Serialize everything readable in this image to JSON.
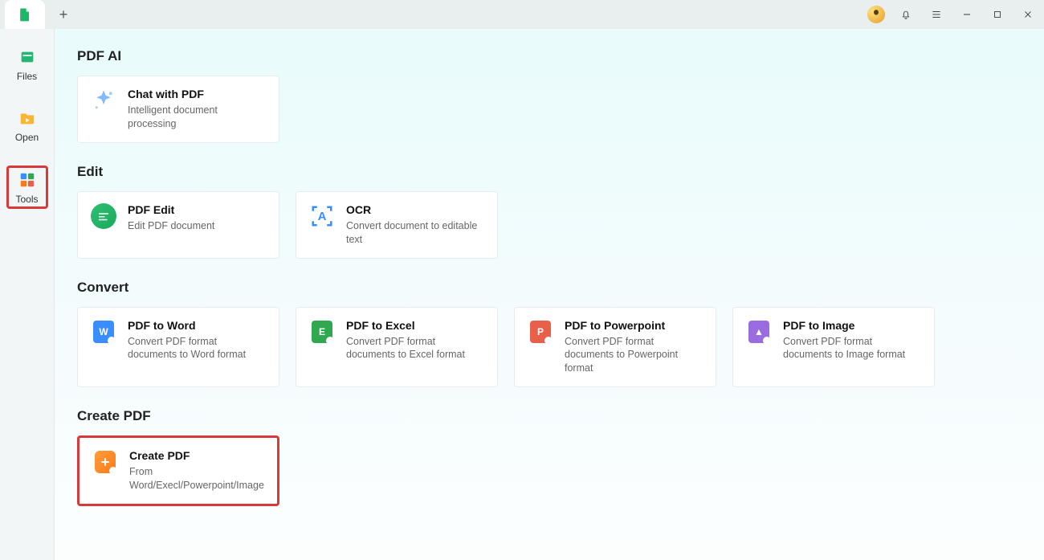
{
  "titlebar": {
    "plus_label": "+"
  },
  "sidebar": {
    "items": [
      {
        "label": "Files"
      },
      {
        "label": "Open"
      },
      {
        "label": "Tools"
      }
    ]
  },
  "sections": {
    "ai": {
      "title": "PDF AI",
      "cards": [
        {
          "title": "Chat with PDF",
          "sub": "Intelligent document processing"
        }
      ]
    },
    "edit": {
      "title": "Edit",
      "cards": [
        {
          "title": "PDF Edit",
          "sub": "Edit PDF document"
        },
        {
          "title": "OCR",
          "sub": "Convert document to editable text"
        }
      ]
    },
    "convert": {
      "title": "Convert",
      "cards": [
        {
          "title": "PDF to Word",
          "sub": "Convert PDF format documents to Word format"
        },
        {
          "title": "PDF to Excel",
          "sub": "Convert PDF format documents to Excel format"
        },
        {
          "title": "PDF to Powerpoint",
          "sub": "Convert PDF format documents to Powerpoint format"
        },
        {
          "title": "PDF to Image",
          "sub": "Convert PDF format documents to Image format"
        }
      ]
    },
    "create": {
      "title": "Create PDF",
      "cards": [
        {
          "title": "Create PDF",
          "sub": "From Word/Execl/Powerpoint/Image"
        }
      ]
    }
  }
}
